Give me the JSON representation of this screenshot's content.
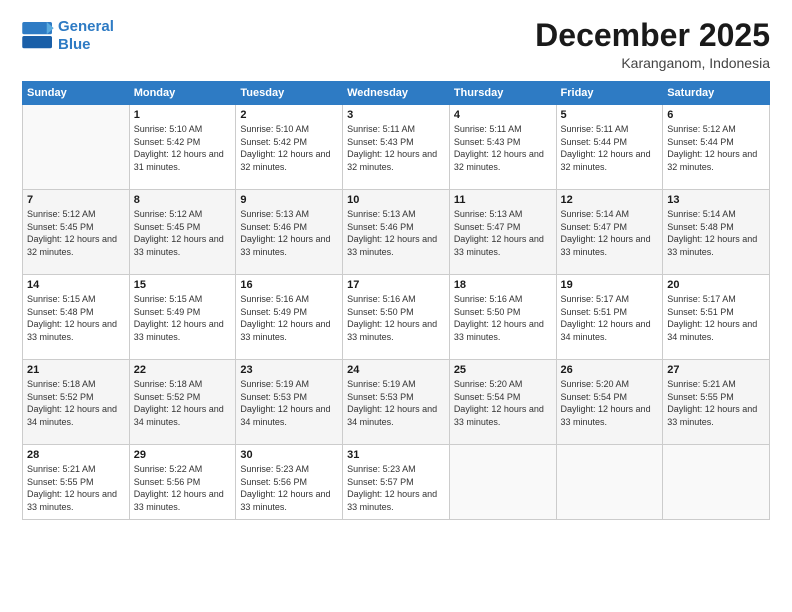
{
  "logo": {
    "line1": "General",
    "line2": "Blue"
  },
  "header": {
    "title": "December 2025",
    "subtitle": "Karanganom, Indonesia"
  },
  "weekdays": [
    "Sunday",
    "Monday",
    "Tuesday",
    "Wednesday",
    "Thursday",
    "Friday",
    "Saturday"
  ],
  "weeks": [
    [
      {
        "day": "",
        "sunrise": "",
        "sunset": "",
        "daylight": ""
      },
      {
        "day": "1",
        "sunrise": "Sunrise: 5:10 AM",
        "sunset": "Sunset: 5:42 PM",
        "daylight": "Daylight: 12 hours and 31 minutes."
      },
      {
        "day": "2",
        "sunrise": "Sunrise: 5:10 AM",
        "sunset": "Sunset: 5:42 PM",
        "daylight": "Daylight: 12 hours and 32 minutes."
      },
      {
        "day": "3",
        "sunrise": "Sunrise: 5:11 AM",
        "sunset": "Sunset: 5:43 PM",
        "daylight": "Daylight: 12 hours and 32 minutes."
      },
      {
        "day": "4",
        "sunrise": "Sunrise: 5:11 AM",
        "sunset": "Sunset: 5:43 PM",
        "daylight": "Daylight: 12 hours and 32 minutes."
      },
      {
        "day": "5",
        "sunrise": "Sunrise: 5:11 AM",
        "sunset": "Sunset: 5:44 PM",
        "daylight": "Daylight: 12 hours and 32 minutes."
      },
      {
        "day": "6",
        "sunrise": "Sunrise: 5:12 AM",
        "sunset": "Sunset: 5:44 PM",
        "daylight": "Daylight: 12 hours and 32 minutes."
      }
    ],
    [
      {
        "day": "7",
        "sunrise": "Sunrise: 5:12 AM",
        "sunset": "Sunset: 5:45 PM",
        "daylight": "Daylight: 12 hours and 32 minutes."
      },
      {
        "day": "8",
        "sunrise": "Sunrise: 5:12 AM",
        "sunset": "Sunset: 5:45 PM",
        "daylight": "Daylight: 12 hours and 33 minutes."
      },
      {
        "day": "9",
        "sunrise": "Sunrise: 5:13 AM",
        "sunset": "Sunset: 5:46 PM",
        "daylight": "Daylight: 12 hours and 33 minutes."
      },
      {
        "day": "10",
        "sunrise": "Sunrise: 5:13 AM",
        "sunset": "Sunset: 5:46 PM",
        "daylight": "Daylight: 12 hours and 33 minutes."
      },
      {
        "day": "11",
        "sunrise": "Sunrise: 5:13 AM",
        "sunset": "Sunset: 5:47 PM",
        "daylight": "Daylight: 12 hours and 33 minutes."
      },
      {
        "day": "12",
        "sunrise": "Sunrise: 5:14 AM",
        "sunset": "Sunset: 5:47 PM",
        "daylight": "Daylight: 12 hours and 33 minutes."
      },
      {
        "day": "13",
        "sunrise": "Sunrise: 5:14 AM",
        "sunset": "Sunset: 5:48 PM",
        "daylight": "Daylight: 12 hours and 33 minutes."
      }
    ],
    [
      {
        "day": "14",
        "sunrise": "Sunrise: 5:15 AM",
        "sunset": "Sunset: 5:48 PM",
        "daylight": "Daylight: 12 hours and 33 minutes."
      },
      {
        "day": "15",
        "sunrise": "Sunrise: 5:15 AM",
        "sunset": "Sunset: 5:49 PM",
        "daylight": "Daylight: 12 hours and 33 minutes."
      },
      {
        "day": "16",
        "sunrise": "Sunrise: 5:16 AM",
        "sunset": "Sunset: 5:49 PM",
        "daylight": "Daylight: 12 hours and 33 minutes."
      },
      {
        "day": "17",
        "sunrise": "Sunrise: 5:16 AM",
        "sunset": "Sunset: 5:50 PM",
        "daylight": "Daylight: 12 hours and 33 minutes."
      },
      {
        "day": "18",
        "sunrise": "Sunrise: 5:16 AM",
        "sunset": "Sunset: 5:50 PM",
        "daylight": "Daylight: 12 hours and 33 minutes."
      },
      {
        "day": "19",
        "sunrise": "Sunrise: 5:17 AM",
        "sunset": "Sunset: 5:51 PM",
        "daylight": "Daylight: 12 hours and 34 minutes."
      },
      {
        "day": "20",
        "sunrise": "Sunrise: 5:17 AM",
        "sunset": "Sunset: 5:51 PM",
        "daylight": "Daylight: 12 hours and 34 minutes."
      }
    ],
    [
      {
        "day": "21",
        "sunrise": "Sunrise: 5:18 AM",
        "sunset": "Sunset: 5:52 PM",
        "daylight": "Daylight: 12 hours and 34 minutes."
      },
      {
        "day": "22",
        "sunrise": "Sunrise: 5:18 AM",
        "sunset": "Sunset: 5:52 PM",
        "daylight": "Daylight: 12 hours and 34 minutes."
      },
      {
        "day": "23",
        "sunrise": "Sunrise: 5:19 AM",
        "sunset": "Sunset: 5:53 PM",
        "daylight": "Daylight: 12 hours and 34 minutes."
      },
      {
        "day": "24",
        "sunrise": "Sunrise: 5:19 AM",
        "sunset": "Sunset: 5:53 PM",
        "daylight": "Daylight: 12 hours and 34 minutes."
      },
      {
        "day": "25",
        "sunrise": "Sunrise: 5:20 AM",
        "sunset": "Sunset: 5:54 PM",
        "daylight": "Daylight: 12 hours and 33 minutes."
      },
      {
        "day": "26",
        "sunrise": "Sunrise: 5:20 AM",
        "sunset": "Sunset: 5:54 PM",
        "daylight": "Daylight: 12 hours and 33 minutes."
      },
      {
        "day": "27",
        "sunrise": "Sunrise: 5:21 AM",
        "sunset": "Sunset: 5:55 PM",
        "daylight": "Daylight: 12 hours and 33 minutes."
      }
    ],
    [
      {
        "day": "28",
        "sunrise": "Sunrise: 5:21 AM",
        "sunset": "Sunset: 5:55 PM",
        "daylight": "Daylight: 12 hours and 33 minutes."
      },
      {
        "day": "29",
        "sunrise": "Sunrise: 5:22 AM",
        "sunset": "Sunset: 5:56 PM",
        "daylight": "Daylight: 12 hours and 33 minutes."
      },
      {
        "day": "30",
        "sunrise": "Sunrise: 5:23 AM",
        "sunset": "Sunset: 5:56 PM",
        "daylight": "Daylight: 12 hours and 33 minutes."
      },
      {
        "day": "31",
        "sunrise": "Sunrise: 5:23 AM",
        "sunset": "Sunset: 5:57 PM",
        "daylight": "Daylight: 12 hours and 33 minutes."
      },
      {
        "day": "",
        "sunrise": "",
        "sunset": "",
        "daylight": ""
      },
      {
        "day": "",
        "sunrise": "",
        "sunset": "",
        "daylight": ""
      },
      {
        "day": "",
        "sunrise": "",
        "sunset": "",
        "daylight": ""
      }
    ]
  ]
}
